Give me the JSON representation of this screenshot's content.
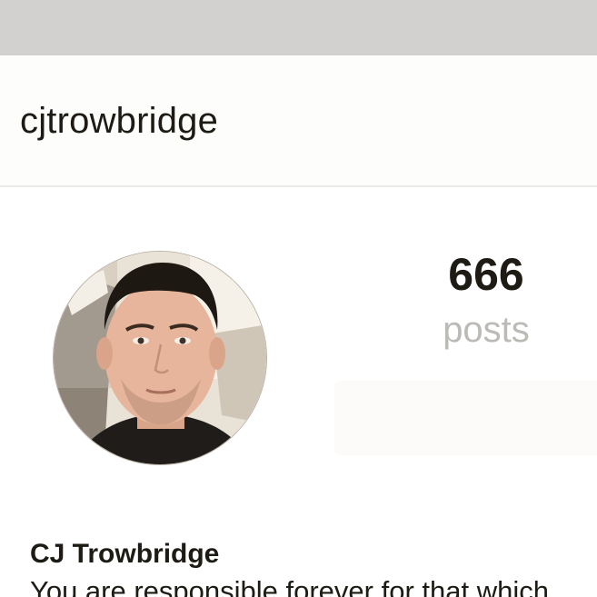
{
  "profile": {
    "username": "cjtrowbridge",
    "posts_count": "666",
    "posts_label": "posts",
    "full_name": "CJ Trowbridge",
    "bio": "You are responsible forever for that which"
  },
  "icons": {
    "avatar": "profile-photo"
  },
  "colors": {
    "status_bar": "#d2d1cf",
    "text_primary": "#1d1b14",
    "text_muted": "#bcbab6"
  }
}
